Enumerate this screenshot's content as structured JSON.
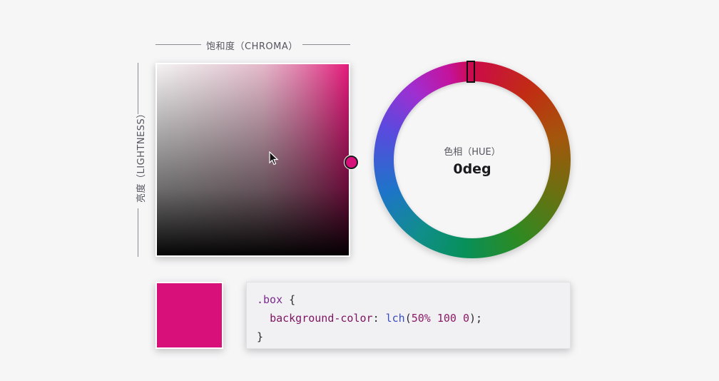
{
  "chroma_axis": {
    "label": "饱和度（CHROMA）"
  },
  "lightness_axis": {
    "label": "亮度（LIGHTNESS）"
  },
  "hue_wheel": {
    "label": "色相（HUE）",
    "value": "0deg"
  },
  "colors": {
    "selected": "#d7107a",
    "picker_max_chroma": "#e5197b",
    "background": "#f6f6f7"
  },
  "code": {
    "selector": ".box",
    "open_brace": "{",
    "property": "background-color",
    "colon": ":",
    "fn": "lch",
    "open_paren": "(",
    "lightness": "50%",
    "chroma": "100",
    "hue": "0",
    "close_paren_semi": ");",
    "close_brace": "}"
  },
  "icons": {
    "cursor": "mouse-pointer-icon",
    "picker_thumb": "circle-handle-icon",
    "hue_handle": "rect-handle-icon"
  }
}
